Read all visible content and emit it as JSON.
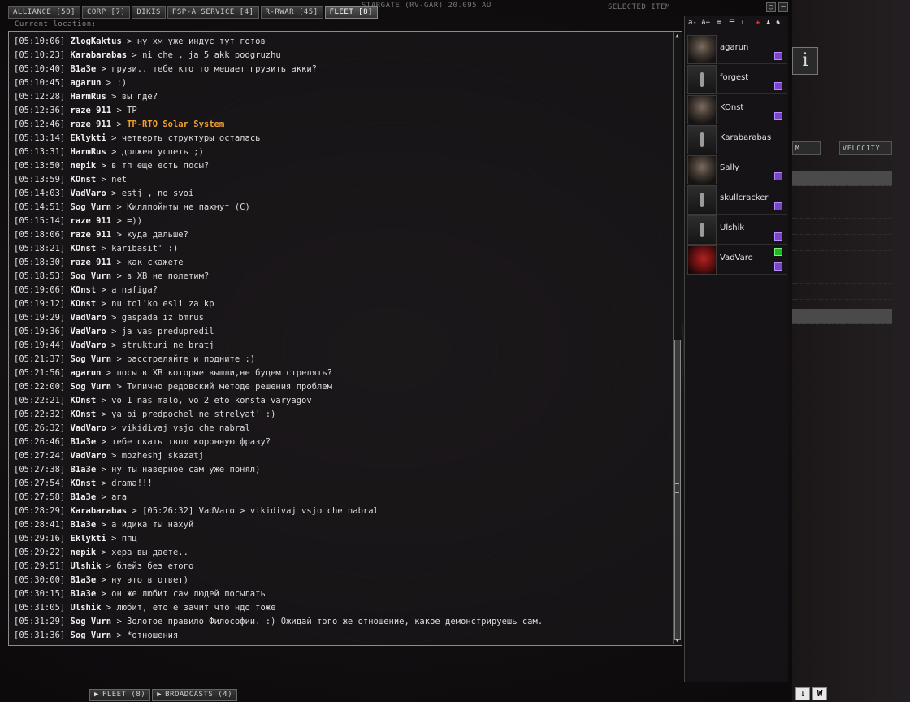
{
  "tabs": [
    {
      "label": "ALLIANCE [50]"
    },
    {
      "label": "CORP [7]"
    },
    {
      "label": "DIKIS"
    },
    {
      "label": "FSP-A SERVICE [4]"
    },
    {
      "label": "R-RWAR [45]"
    },
    {
      "label": "FLEET [8]"
    }
  ],
  "background": {
    "stargate_label": "STARGATE (RV-GAR) 20.095 AU",
    "current_location": "Current location:",
    "selected_item": "SELECTED ITEM",
    "overview_col_velocity": "VELOCITY",
    "overview_col_m": "M"
  },
  "chat": {
    "messages": [
      {
        "time": "[05:10:06]",
        "nick": "ZlogKaktus",
        "text": "ну хм уже индус тут готов"
      },
      {
        "time": "[05:10:23]",
        "nick": "Karabarabas",
        "text": "ni che , ja 5 akk podgruzhu"
      },
      {
        "time": "[05:10:40]",
        "nick": "B1a3e",
        "text": "грузи.. тебе кто то мешает грузить акки?"
      },
      {
        "time": "[05:10:45]",
        "nick": "agarun",
        "text": ":)"
      },
      {
        "time": "[05:12:28]",
        "nick": "HarmRus",
        "text": "вы где?"
      },
      {
        "time": "[05:12:36]",
        "nick": "raze 911",
        "text": "TP"
      },
      {
        "time": "[05:12:46]",
        "nick": "raze 911",
        "text": "TP-RTO Solar System",
        "link": true
      },
      {
        "time": "[05:13:14]",
        "nick": "Eklykti",
        "text": "четверть структуры осталась"
      },
      {
        "time": "[05:13:31]",
        "nick": "HarmRus",
        "text": "должен успеть ;)"
      },
      {
        "time": "[05:13:50]",
        "nick": "nepik",
        "text": "в тп еще есть посы?"
      },
      {
        "time": "[05:13:59]",
        "nick": "KOnst",
        "text": "net"
      },
      {
        "time": "[05:14:03]",
        "nick": "VadVaro",
        "text": "estj , no svoi"
      },
      {
        "time": "[05:14:51]",
        "nick": "Sog Vurn",
        "text": "Киллпойнты не пахнут (С)"
      },
      {
        "time": "[05:15:14]",
        "nick": "raze 911",
        "text": "=))"
      },
      {
        "time": "[05:18:06]",
        "nick": "raze 911",
        "text": "куда дальше?"
      },
      {
        "time": "[05:18:21]",
        "nick": "KOnst",
        "text": "karibasit' :)"
      },
      {
        "time": "[05:18:30]",
        "nick": "raze 911",
        "text": "как скажете"
      },
      {
        "time": "[05:18:53]",
        "nick": "Sog Vurn",
        "text": "в ХВ не полетим?"
      },
      {
        "time": "[05:19:06]",
        "nick": "KOnst",
        "text": "a nafiga?"
      },
      {
        "time": "[05:19:12]",
        "nick": "KOnst",
        "text": "nu tol'ko esli za kp"
      },
      {
        "time": "[05:19:29]",
        "nick": "VadVaro",
        "text": "gaspada iz bmrus"
      },
      {
        "time": "[05:19:36]",
        "nick": "VadVaro",
        "text": "ja vas predupredil"
      },
      {
        "time": "[05:19:44]",
        "nick": "VadVaro",
        "text": "strukturi ne bratj"
      },
      {
        "time": "[05:21:37]",
        "nick": "Sog Vurn",
        "text": "расстреляйте и подните :)"
      },
      {
        "time": "[05:21:56]",
        "nick": "agarun",
        "text": "посы в ХВ которые вышли,не будем стрелять?"
      },
      {
        "time": "[05:22:00]",
        "nick": "Sog Vurn",
        "text": "Типично редовский методе решения проблем"
      },
      {
        "time": "[05:22:21]",
        "nick": "KOnst",
        "text": "vo 1 nas malo, vo 2 eto konsta varyagov"
      },
      {
        "time": "[05:22:32]",
        "nick": "KOnst",
        "text": "ya bi predpochel ne strelyat' :)"
      },
      {
        "time": "[05:26:32]",
        "nick": "VadVaro",
        "text": "vikidivaj vsjo che nabral"
      },
      {
        "time": "[05:26:46]",
        "nick": "B1a3e",
        "text": "тебе скать твою коронную фразу?"
      },
      {
        "time": "[05:27:24]",
        "nick": "VadVaro",
        "text": "mozheshj skazatj"
      },
      {
        "time": "[05:27:38]",
        "nick": "B1a3e",
        "text": "ну ты наверное сам уже понял)"
      },
      {
        "time": "[05:27:54]",
        "nick": "KOnst",
        "text": "drama!!!"
      },
      {
        "time": "[05:27:58]",
        "nick": "B1a3e",
        "text": "ага"
      },
      {
        "time": "[05:28:29]",
        "nick": "Karabarabas",
        "text": "[05:26:32] VadVaro > vikidivaj vsjo che nabral"
      },
      {
        "time": "[05:28:41]",
        "nick": "B1a3e",
        "text": "а идика ты нахуй"
      },
      {
        "time": "[05:29:16]",
        "nick": "Eklykti",
        "text": "ппц"
      },
      {
        "time": "[05:29:22]",
        "nick": "nepik",
        "text": "хера вы даете.."
      },
      {
        "time": "[05:29:51]",
        "nick": "Ulshik",
        "text": "блейз без етого"
      },
      {
        "time": "[05:30:00]",
        "nick": "B1a3e",
        "text": "ну это в ответ)"
      },
      {
        "time": "[05:30:15]",
        "nick": "B1a3e",
        "text": "он же любит сам людей посылать"
      },
      {
        "time": "[05:31:05]",
        "nick": "Ulshik",
        "text": "любит, ето е зачит что ндо тоже"
      },
      {
        "time": "[05:31:29]",
        "nick": "Sog Vurn",
        "text": "Золотое правило Философии. :) Ожидай того же отношение, какое демонстрируешь сам."
      },
      {
        "time": "[05:31:36]",
        "nick": "Sog Vurn",
        "text": "*отношения"
      }
    ]
  },
  "members": [
    {
      "name": "agarun",
      "portrait": "photo",
      "badge": "purple"
    },
    {
      "name": "forgest",
      "portrait": "silhouette",
      "badge": "purple"
    },
    {
      "name": "KOnst",
      "portrait": "photo",
      "badge": "purple"
    },
    {
      "name": "Karabarabas",
      "portrait": "silhouette",
      "badge": "none"
    },
    {
      "name": "Sally",
      "portrait": "photo",
      "badge": "purple"
    },
    {
      "name": "skullcracker",
      "portrait": "silhouette",
      "badge": "purple"
    },
    {
      "name": "Ulshik",
      "portrait": "silhouette",
      "badge": "purple"
    },
    {
      "name": "VadVaro",
      "portrait": "red",
      "badge": "green+purple"
    }
  ],
  "member_toolbar": {
    "font_label": "a- A+"
  },
  "bottom_tabs": [
    {
      "label": "FLEET (8)"
    },
    {
      "label": "BROADCASTS (4)"
    }
  ],
  "corner_buttons": {
    "down": "⇓",
    "w": "W"
  },
  "info_icon": "i"
}
